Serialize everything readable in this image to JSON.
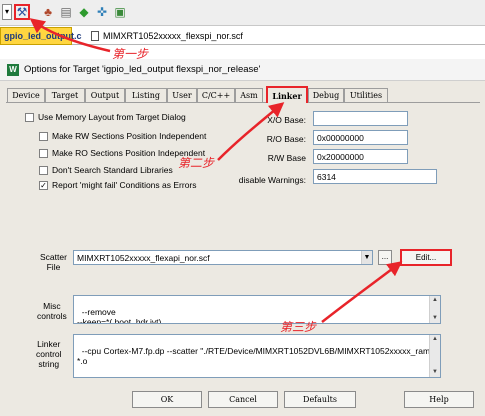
{
  "toolbar": {
    "buttons": [
      {
        "icon": "dropdown-arrow-icon",
        "glyph": "▾"
      },
      {
        "icon": "options-for-target-icon",
        "glyph": "⚒"
      },
      {
        "icon": "manage-components-icon",
        "glyph": "♣"
      },
      {
        "icon": "file-extensions-icon",
        "glyph": "▤"
      },
      {
        "icon": "pack-installer-icon",
        "glyph": "◆"
      },
      {
        "icon": "select-packs-icon",
        "glyph": "✜"
      },
      {
        "icon": "manage-run-time-icon",
        "glyph": "▣"
      }
    ]
  },
  "file_tabs": [
    {
      "label": "gpio_led_output.c",
      "active": true
    },
    {
      "label": "MIMXRT1052xxxxx_flexspi_nor.scf",
      "active": false
    }
  ],
  "dialog": {
    "title": "Options for Target 'igpio_led_output flexspi_nor_release'",
    "logo": "W",
    "tabs": [
      "Device",
      "Target",
      "Output",
      "Listing",
      "User",
      "C/C++",
      "Asm",
      "Linker",
      "Debug",
      "Utilities"
    ],
    "selected_tab": "Linker",
    "checkboxes": [
      {
        "label": "Use Memory Layout from Target Dialog",
        "checked": false
      },
      {
        "label": "Make RW Sections Position Independent",
        "checked": false
      },
      {
        "label": "Make RO Sections Position Independent",
        "checked": false
      },
      {
        "label": "Don't Search Standard Libraries",
        "checked": false
      },
      {
        "label": "Report 'might fail' Conditions as Errors",
        "checked": true
      }
    ],
    "fields": {
      "xo_base": {
        "label": "X/O Base:",
        "value": ""
      },
      "ro_base": {
        "label": "R/O Base:",
        "value": "0x00000000"
      },
      "rw_base": {
        "label": "R/W Base",
        "value": "0x20000000"
      },
      "disable_warnings": {
        "label": "disable Warnings:",
        "value": "6314"
      }
    },
    "scatter": {
      "label_line1": "Scatter",
      "label_line2": "File",
      "value": "MIMXRT1052xxxxx_flexapi_nor.scf",
      "browse": "...",
      "edit": "Edit..."
    },
    "misc": {
      "label_line1": "Misc",
      "label_line2": "controls",
      "value": "--remove\n--keep=*(.boot_hdr.ivt)"
    },
    "linker_string": {
      "label_line1": "Linker",
      "label_line2": "control",
      "label_line3": "string",
      "value": "--cpu Cortex-M7.fp.dp --scatter \"./RTE/Device/MIMXRT1052DVL6B/MIMXRT1052xxxxx_ram.scf\"\n*.o"
    },
    "buttons": {
      "ok": "OK",
      "cancel": "Cancel",
      "defaults": "Defaults",
      "help": "Help"
    }
  },
  "annotations": {
    "step1": "第一步",
    "step2": "第二步",
    "step3": "第三步",
    "color": "#e8242a"
  }
}
